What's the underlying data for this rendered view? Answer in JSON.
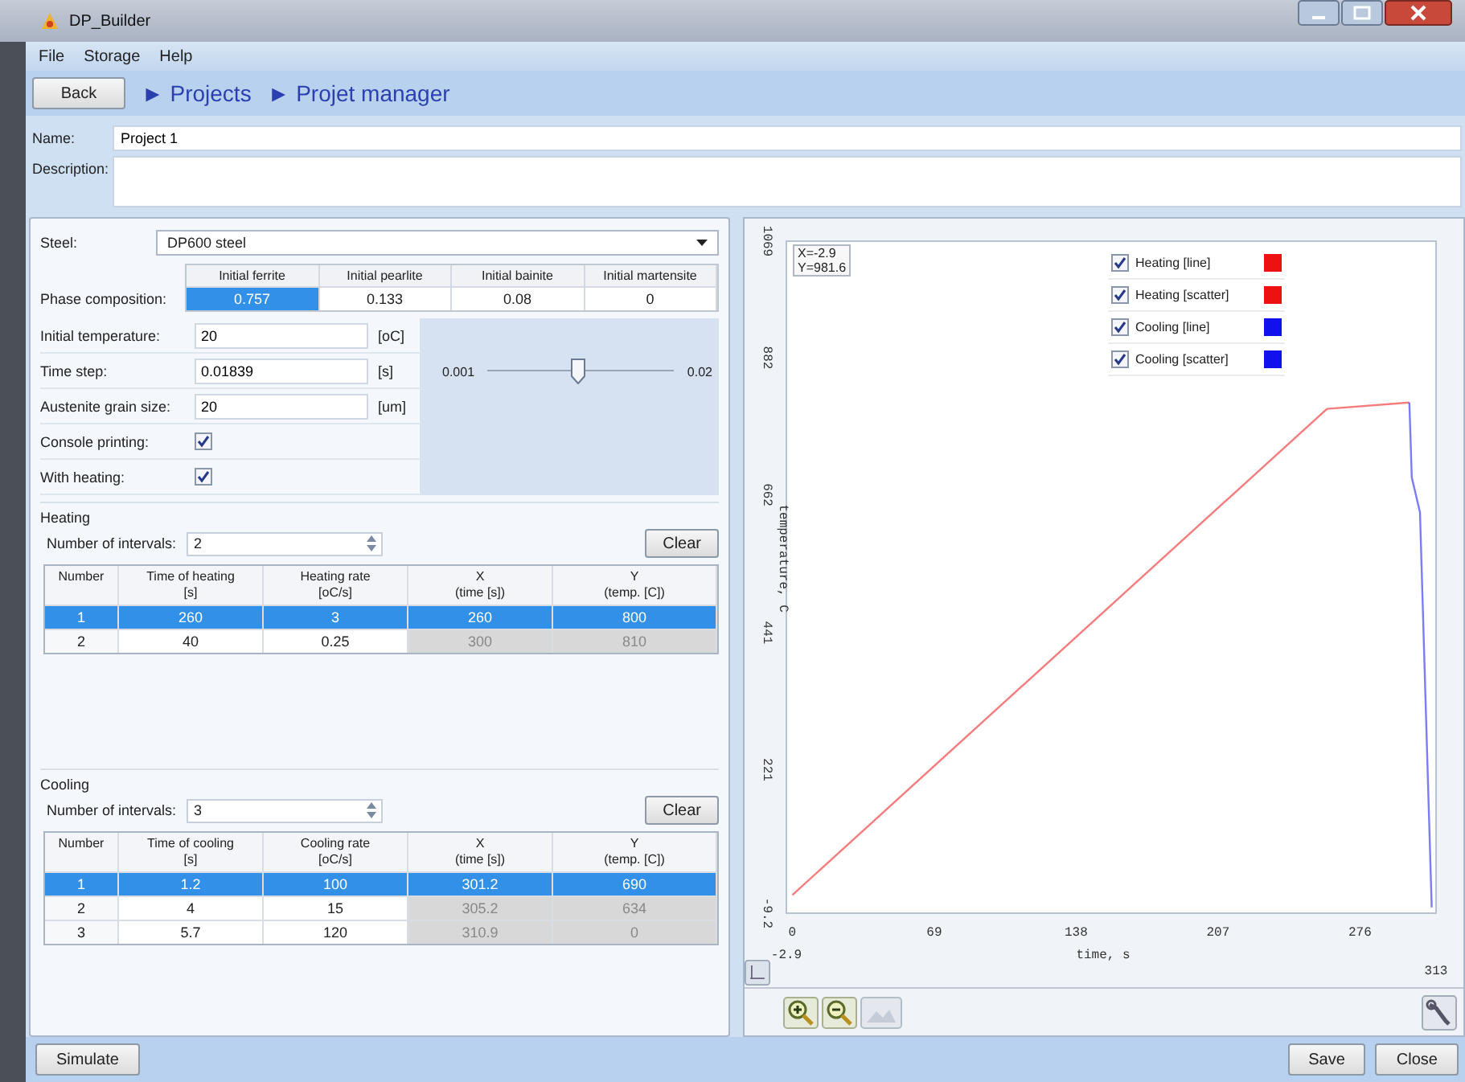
{
  "window": {
    "title": "DP_Builder"
  },
  "menu": [
    "File",
    "Storage",
    "Help"
  ],
  "nav": {
    "back": "Back",
    "breadcrumb": [
      "► Projects",
      "► Projet manager"
    ]
  },
  "project": {
    "name_label": "Name:",
    "name": "Project 1",
    "description_label": "Description:"
  },
  "steel": {
    "label": "Steel:",
    "value": "DP600 steel"
  },
  "phase": {
    "label": "Phase composition:",
    "columns": [
      {
        "header": "Initial ferrite",
        "value": "0.757",
        "selected": true
      },
      {
        "header": "Initial pearlite",
        "value": "0.133",
        "selected": false
      },
      {
        "header": "Initial bainite",
        "value": "0.08",
        "selected": false
      },
      {
        "header": "Initial martensite",
        "value": "0",
        "selected": false
      }
    ]
  },
  "params": [
    {
      "kind": "field",
      "label": "Initial temperature:",
      "value": "20",
      "unit": "[oC]"
    },
    {
      "kind": "field",
      "label": "Time step:",
      "value": "0.01839",
      "unit": "[s]"
    },
    {
      "kind": "field",
      "label": "Austenite grain size:",
      "value": "20",
      "unit": "[um]"
    },
    {
      "kind": "check",
      "label": "Console printing:",
      "checked": true
    },
    {
      "kind": "check",
      "label": "With heating:",
      "checked": true
    }
  ],
  "slider": {
    "min": "0.001",
    "max": "0.02",
    "level": 0.48
  },
  "heating": {
    "title": "Heating",
    "intervals_label": "Number of intervals:",
    "intervals": "2",
    "clear": "Clear",
    "columns": [
      {
        "header": "Number",
        "readonly": false
      },
      {
        "header": "Time of heating\n[s]",
        "readonly": false
      },
      {
        "header": "Heating rate\n[oC/s]",
        "readonly": false
      },
      {
        "header": "X\n(time [s])",
        "readonly": true
      },
      {
        "header": "Y\n(temp. [C])",
        "readonly": true
      }
    ],
    "rows": [
      {
        "selected": true,
        "cells": [
          "1",
          "260",
          "3",
          "260",
          "800"
        ]
      },
      {
        "selected": false,
        "cells": [
          "2",
          "40",
          "0.25",
          "300",
          "810"
        ]
      }
    ]
  },
  "cooling": {
    "title": "Cooling",
    "intervals_label": "Number of intervals:",
    "intervals": "3",
    "clear": "Clear",
    "columns": [
      {
        "header": "Number",
        "readonly": false
      },
      {
        "header": "Time of cooling\n[s]",
        "readonly": false
      },
      {
        "header": "Cooling rate\n[oC/s]",
        "readonly": false
      },
      {
        "header": "X\n(time [s])",
        "readonly": true
      },
      {
        "header": "Y\n(temp. [C])",
        "readonly": true
      }
    ],
    "rows": [
      {
        "selected": true,
        "cells": [
          "1",
          "1.2",
          "100",
          "301.2",
          "690"
        ]
      },
      {
        "selected": false,
        "cells": [
          "2",
          "4",
          "15",
          "305.2",
          "634"
        ]
      },
      {
        "selected": false,
        "cells": [
          "3",
          "5.7",
          "120",
          "310.9",
          "0"
        ]
      }
    ]
  },
  "chart": {
    "cursor": [
      "X=-2.9",
      "Y=981.6"
    ],
    "legend": [
      {
        "label": "Heating [line]",
        "checked": true,
        "color": "#ee1111"
      },
      {
        "label": "Heating [scatter]",
        "checked": true,
        "color": "#ee1111"
      },
      {
        "label": "Cooling [line]",
        "checked": true,
        "color": "#1111ee"
      },
      {
        "label": "Cooling [scatter]",
        "checked": true,
        "color": "#1111ee"
      }
    ],
    "y_range_labels": [
      "1069",
      "-9.2"
    ],
    "x_range_labels": [
      "-2.9",
      "313"
    ],
    "chart_data": {
      "type": "line",
      "xlabel": "time, s",
      "ylabel": "temperature, C",
      "x": [
        0,
        260,
        300,
        301.2,
        305.2,
        310.9
      ],
      "series": [
        {
          "color": "#ee1111",
          "values": [
            20,
            800,
            810,
            null,
            null,
            null
          ]
        },
        {
          "color": "#1111ee",
          "values": [
            null,
            null,
            810,
            690,
            634,
            0
          ]
        }
      ],
      "xlim": [
        -2.9,
        313
      ],
      "ylim": [
        -9.2,
        1069
      ],
      "xticks": [
        0,
        69,
        138,
        207,
        276
      ],
      "yticks": [
        221,
        441,
        662,
        882
      ]
    }
  },
  "buttons": {
    "simulate": "Simulate",
    "save": "Save",
    "close": "Close"
  }
}
